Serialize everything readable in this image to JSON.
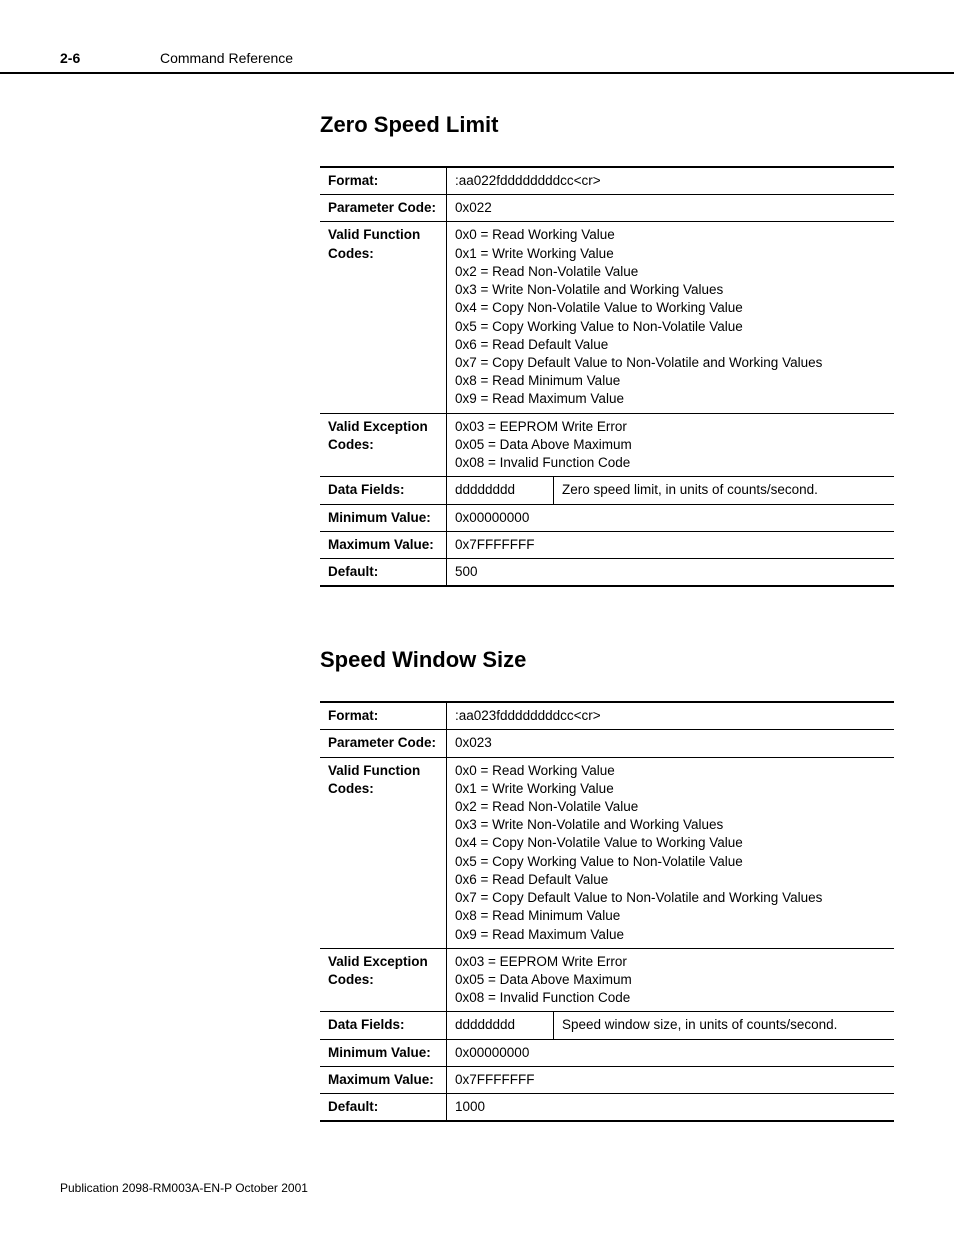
{
  "header": {
    "page_number": "2-6",
    "section": "Command Reference"
  },
  "sections": [
    {
      "title": "Zero Speed Limit",
      "rows": {
        "format_label": "Format:",
        "format_value": ":aa022fddddddddcc<cr>",
        "param_label": "Parameter Code:",
        "param_value": "0x022",
        "fn_label": "Valid Function Codes:",
        "fn_0": "0x0 = Read Working Value",
        "fn_1": "0x1 = Write Working Value",
        "fn_2": "0x2 = Read Non-Volatile Value",
        "fn_3": "0x3 = Write Non-Volatile and Working Values",
        "fn_4": "0x4 = Copy Non-Volatile Value to Working Value",
        "fn_5": "0x5 = Copy Working Value to Non-Volatile Value",
        "fn_6": "0x6 = Read Default Value",
        "fn_7": "0x7 = Copy Default Value to Non-Volatile and Working Values",
        "fn_8": "0x8 = Read Minimum Value",
        "fn_9": "0x9 = Read Maximum Value",
        "ex_label": "Valid Exception Codes:",
        "ex_0": "0x03 = EEPROM Write Error",
        "ex_1": "0x05 = Data Above Maximum",
        "ex_2": "0x08 = Invalid Function Code",
        "df_label": "Data Fields:",
        "df_field": "dddddddd",
        "df_desc": "Zero speed limit, in units of counts/second.",
        "min_label": "Minimum Value:",
        "min_value": "0x00000000",
        "max_label": "Maximum Value:",
        "max_value": "0x7FFFFFFF",
        "def_label": "Default:",
        "def_value": "500"
      }
    },
    {
      "title": "Speed Window Size",
      "rows": {
        "format_label": "Format:",
        "format_value": ":aa023fddddddddcc<cr>",
        "param_label": "Parameter Code:",
        "param_value": "0x023",
        "fn_label": "Valid Function Codes:",
        "fn_0": "0x0 = Read Working Value",
        "fn_1": "0x1 = Write Working Value",
        "fn_2": "0x2 = Read Non-Volatile Value",
        "fn_3": "0x3 = Write Non-Volatile and Working Values",
        "fn_4": "0x4 = Copy Non-Volatile Value to Working Value",
        "fn_5": "0x5 = Copy Working Value to Non-Volatile Value",
        "fn_6": "0x6 = Read Default Value",
        "fn_7": "0x7 = Copy Default Value to Non-Volatile and Working Values",
        "fn_8": "0x8 = Read Minimum Value",
        "fn_9": "0x9 = Read Maximum Value",
        "ex_label": "Valid Exception Codes:",
        "ex_0": "0x03 = EEPROM Write Error",
        "ex_1": "0x05 = Data Above Maximum",
        "ex_2": "0x08 = Invalid Function Code",
        "df_label": "Data Fields:",
        "df_field": "dddddddd",
        "df_desc": "Speed window size, in units of counts/second.",
        "min_label": "Minimum Value:",
        "min_value": "0x00000000",
        "max_label": "Maximum Value:",
        "max_value": "0x7FFFFFFF",
        "def_label": "Default:",
        "def_value": "1000"
      }
    }
  ],
  "footer": "Publication 2098-RM003A-EN-P October 2001"
}
